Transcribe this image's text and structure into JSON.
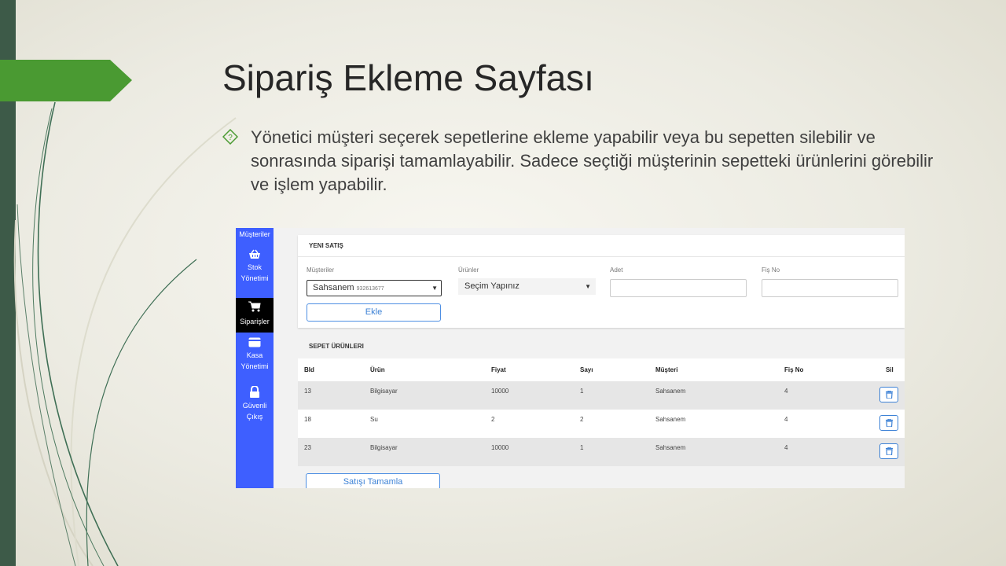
{
  "slide": {
    "title": "Sipariş Ekleme Sayfası",
    "bullet": "Yönetici müşteri seçerek sepetlerine ekleme yapabilir veya bu sepetten silebilir ve sonrasında siparişi tamamlayabilir. Sadece seçtiği müşterinin sepetteki ürünlerini görebilir ve işlem yapabilir.",
    "colors": {
      "accent_green": "#4a9a32",
      "sidebar_blue": "#3e5fff"
    }
  },
  "sidebar": {
    "top_label": "Müşteriler",
    "items": [
      {
        "label": "Stok Yönetimi",
        "icon": "basket-icon"
      },
      {
        "label": "Siparişler",
        "icon": "cart-icon",
        "active": true
      },
      {
        "label": "Kasa Yönetimi",
        "icon": "credit-card-icon"
      },
      {
        "label": "Güvenli Çıkış",
        "icon": "lock-icon"
      }
    ]
  },
  "new_sale": {
    "heading": "YENI SATIŞ",
    "customer_label": "Müşteriler",
    "customer_value": "Sahsanem",
    "customer_code": "932613677",
    "product_label": "Ürünler",
    "product_value": "Seçim Yapınız",
    "quantity_label": "Adet",
    "receipt_label": "Fiş No",
    "add_button": "Ekle"
  },
  "cart": {
    "heading": "SEPET ÜRÜNLERI",
    "columns": [
      "BId",
      "Ürün",
      "Fiyat",
      "Sayı",
      "Müşteri",
      "Fiş No",
      "Sil"
    ],
    "rows": [
      [
        "13",
        "Bilgisayar",
        "10000",
        "1",
        "Sahsanem",
        "4"
      ],
      [
        "18",
        "Su",
        "2",
        "2",
        "Sahsanem",
        "4"
      ],
      [
        "23",
        "Bilgisayar",
        "10000",
        "1",
        "Sahsanem",
        "4"
      ]
    ],
    "complete_button": "Satışı Tamamla"
  }
}
